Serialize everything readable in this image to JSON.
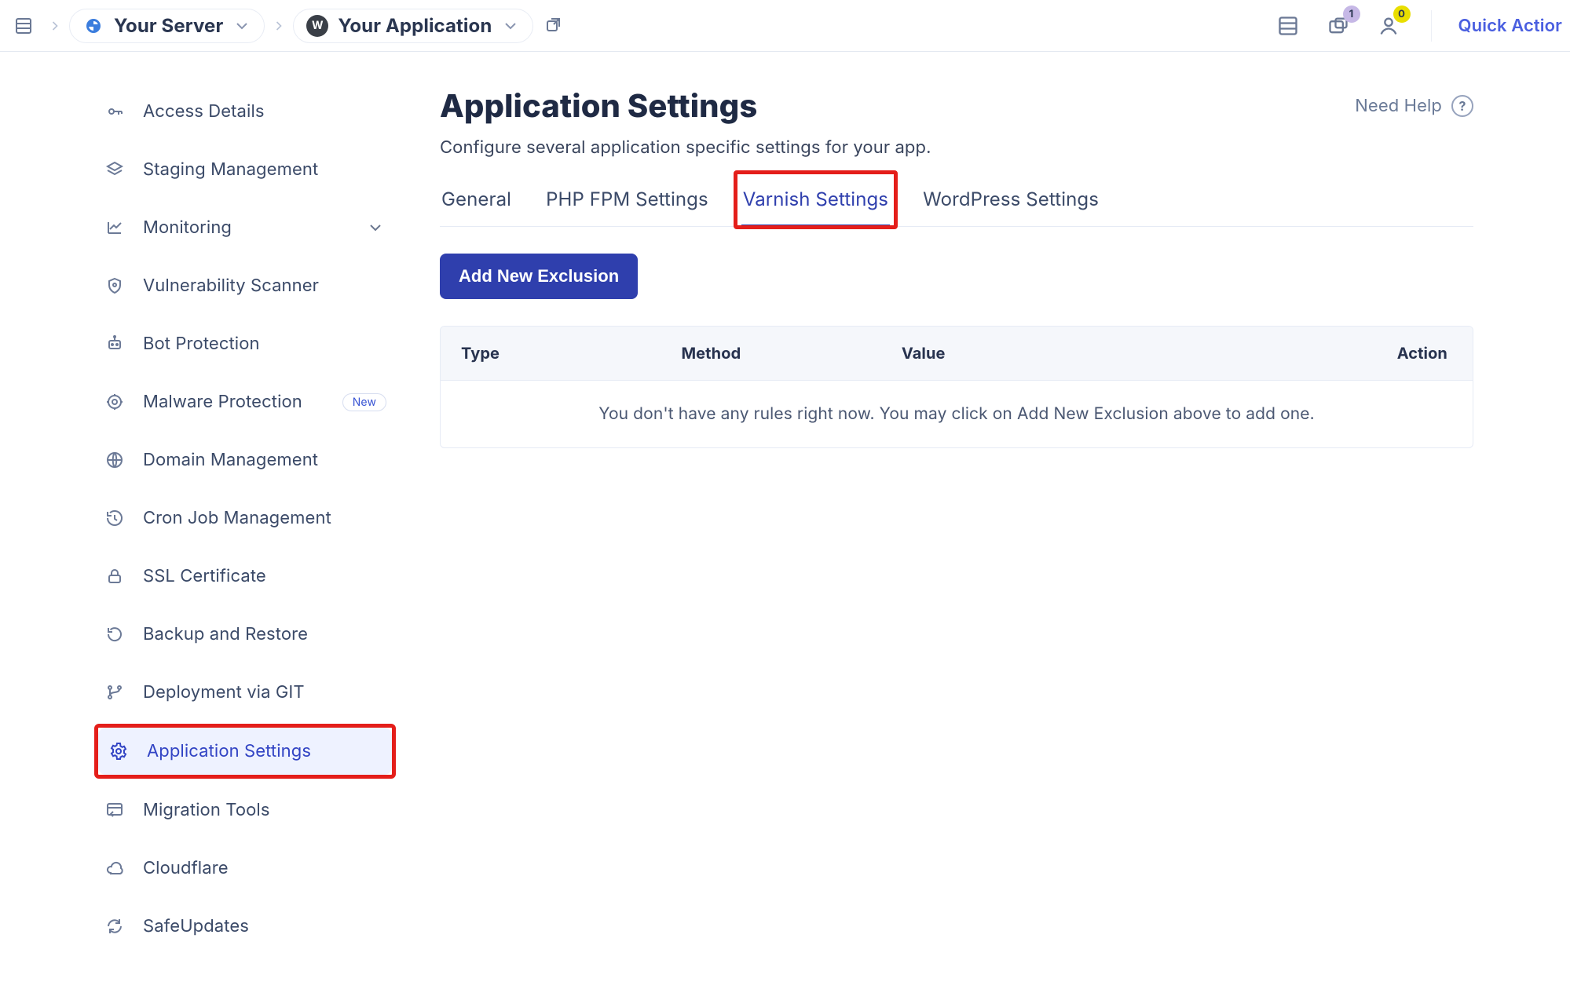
{
  "topbar": {
    "server_label": "Your Server",
    "app_label": "Your Application",
    "quick_action": "Quick Actior",
    "badges": {
      "folder": "1",
      "user": "0"
    }
  },
  "sidebar": {
    "items": [
      {
        "label": "Access Details"
      },
      {
        "label": "Staging Management"
      },
      {
        "label": "Monitoring",
        "has_caret": true
      },
      {
        "label": "Vulnerability Scanner"
      },
      {
        "label": "Bot Protection"
      },
      {
        "label": "Malware Protection",
        "badge": "New"
      },
      {
        "label": "Domain Management"
      },
      {
        "label": "Cron Job Management"
      },
      {
        "label": "SSL Certificate"
      },
      {
        "label": "Backup and Restore"
      },
      {
        "label": "Deployment via GIT"
      },
      {
        "label": "Application Settings",
        "active": true
      },
      {
        "label": "Migration Tools"
      },
      {
        "label": "Cloudflare"
      },
      {
        "label": "SafeUpdates"
      }
    ]
  },
  "main": {
    "title": "Application Settings",
    "subtitle": "Configure several application specific settings for your app.",
    "help_label": "Need Help",
    "tabs": [
      {
        "label": "General"
      },
      {
        "label": "PHP FPM Settings"
      },
      {
        "label": "Varnish Settings",
        "active": true,
        "highlight": true
      },
      {
        "label": "WordPress Settings"
      }
    ],
    "cta": "Add New Exclusion",
    "table": {
      "columns": [
        "Type",
        "Method",
        "Value",
        "Action"
      ],
      "empty": "You don't have any rules right now. You may click on Add New Exclusion above to add one."
    }
  }
}
